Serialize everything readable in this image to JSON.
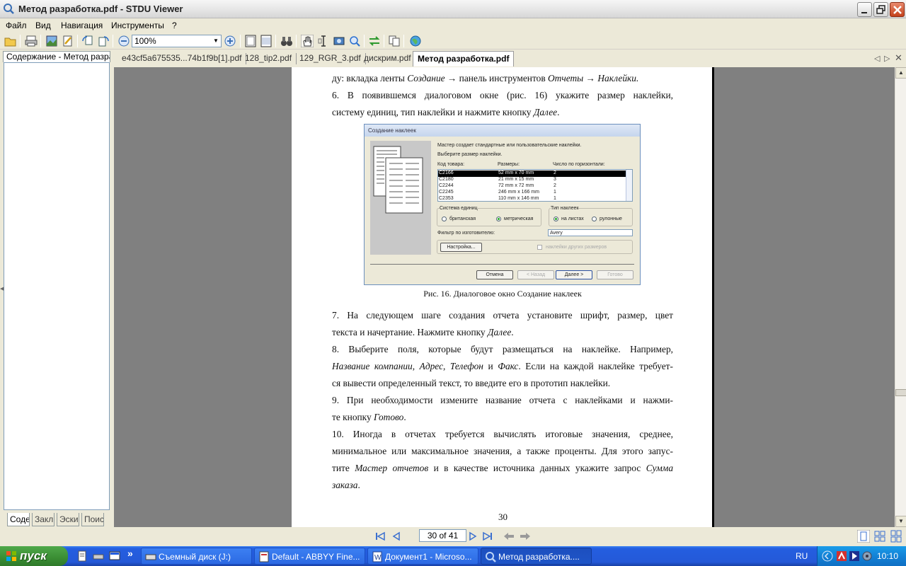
{
  "window": {
    "title": "Метод разработка.pdf - STDU Viewer"
  },
  "menu": {
    "items": [
      "Файл",
      "Вид",
      "Навигация",
      "Инструменты",
      "?"
    ]
  },
  "toolbar": {
    "zoom_value": "100%",
    "more": "»"
  },
  "left_panel": {
    "header_tab": "Содержание - Метод разраб",
    "bottom_tabs": [
      "Соде",
      "Закл",
      "Эски",
      "Поис"
    ]
  },
  "doc_tabs": {
    "tabs": [
      "e43cf5a675535...74b1f9b[1].pdf",
      "128_tip2.pdf",
      "129_RGR_3.pdf",
      "дискрим.pdf",
      "Метод разработка.pdf"
    ],
    "active_index": 4
  },
  "page": {
    "lines": [
      {
        "parts": [
          {
            "t": "ду: вкладка ленты "
          },
          {
            "t": "Создание",
            "i": true
          },
          {
            "t": " → панель инструментов "
          },
          {
            "t": "Отчеты",
            "i": true
          },
          {
            "t": " → "
          },
          {
            "t": "Наклейки.",
            "i": true
          }
        ]
      },
      {
        "parts": [
          {
            "t": "      6.  В появившемся диалоговом окне (рис. 16) укажите размер наклейки,"
          }
        ],
        "justify": true
      },
      {
        "parts": [
          {
            "t": "систему единиц, тип наклейки и нажмите кнопку "
          },
          {
            "t": "Далее",
            "i": true
          },
          {
            "t": "."
          }
        ]
      },
      {
        "parts": [
          {
            "t": "      7.  На следующем шаге создания отчета установите шрифт, размер, цвет"
          }
        ],
        "justify": true
      },
      {
        "parts": [
          {
            "t": "текста и начертание. Нажмите кнопку "
          },
          {
            "t": "Далее",
            "i": true
          },
          {
            "t": "."
          }
        ]
      },
      {
        "parts": [
          {
            "t": "      8.  Выберите поля, которые будут размещаться на наклейке. Например,"
          }
        ],
        "justify": true
      },
      {
        "parts": [
          {
            "t": "Название компании",
            "i": true
          },
          {
            "t": ", "
          },
          {
            "t": "Адрес",
            "i": true
          },
          {
            "t": ", "
          },
          {
            "t": "Телефон",
            "i": true
          },
          {
            "t": " и "
          },
          {
            "t": "Факс",
            "i": true
          },
          {
            "t": ". Если на каждой наклейке требует-"
          }
        ],
        "justify": true
      },
      {
        "parts": [
          {
            "t": "ся вывести определенный текст, то введите его в прототип наклейки."
          }
        ]
      },
      {
        "parts": [
          {
            "t": "      9.  При необходимости измените название отчета с наклейками и нажми-"
          }
        ],
        "justify": true
      },
      {
        "parts": [
          {
            "t": "те кнопку "
          },
          {
            "t": "Готово",
            "i": true
          },
          {
            "t": "."
          }
        ]
      },
      {
        "parts": [
          {
            "t": "      10. Иногда в отчетах требуется вычислять итоговые значения, среднее,"
          }
        ],
        "justify": true
      },
      {
        "parts": [
          {
            "t": "минимальное или максимальное значения, а также проценты. Для этого запус-"
          }
        ],
        "justify": true
      },
      {
        "parts": [
          {
            "t": "тите "
          },
          {
            "t": "Мастер отчетов",
            "i": true
          },
          {
            "t": " и в качестве источника данных укажите запрос "
          },
          {
            "t": "Сумма",
            "i": true
          }
        ],
        "justify": true
      },
      {
        "parts": [
          {
            "t": "заказа",
            "i": true
          },
          {
            "t": "."
          }
        ]
      }
    ],
    "caption": "Рис. 16. Диалоговое окно Создание наклеек",
    "page_number": "30"
  },
  "dialog_image": {
    "title": "Создание наклеек",
    "intro": "Мастер создает стандартные или пользовательские наклейки.",
    "choose": "Выберите размер наклейки.",
    "col_code": "Код товара:",
    "col_size": "Размеры:",
    "col_count": "Число по горизонтали:",
    "rows": [
      {
        "code": "C2166",
        "size": "52 mm x 70 mm",
        "count": "2"
      },
      {
        "code": "C2180",
        "size": "21 mm x 15 mm",
        "count": "3"
      },
      {
        "code": "C2244",
        "size": "72 mm x 72 mm",
        "count": "2"
      },
      {
        "code": "C2245",
        "size": "246 mm x 166 mm",
        "count": "1"
      },
      {
        "code": "C2353",
        "size": "110 mm x 146 mm",
        "count": "1"
      }
    ],
    "units_group": "Система единиц",
    "unit_british": "британская",
    "unit_metric": "метрическая",
    "type_group": "Тип наклеек",
    "type_sheet": "на листах",
    "type_roll": "рулонные",
    "filter_label": "Фильтр по изготовителю:",
    "filter_value": "Avery",
    "setup_button": "Настройка...",
    "other_sizes": "наклейки других размеров",
    "btn_cancel": "Отмена",
    "btn_back": "< Назад",
    "btn_next": "Далее >",
    "btn_finish": "Готово"
  },
  "navigation": {
    "page_field": "30 of 41"
  },
  "taskbar": {
    "start_label": "пуск",
    "tasks": [
      "Съемный диск (J:)",
      "Default - ABBYY Fine...",
      "Документ1 - Microso...",
      "Метод разработка...."
    ],
    "active_task": 3,
    "language": "RU",
    "clock": "10:10"
  },
  "colors": {
    "titlebar_bg": "#e4e4e4",
    "chrome_bg": "#ECE9D8",
    "viewer_bg": "#808080",
    "taskbar_blue": "#245ee0",
    "start_green": "#3a8d33",
    "tray_blue": "#1382d6"
  }
}
